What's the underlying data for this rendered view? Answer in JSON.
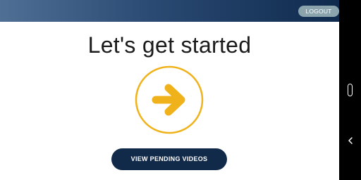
{
  "header": {
    "logout_label": "LOGOUT"
  },
  "main": {
    "title": "Let's get started",
    "start_icon": "arrow-right-icon",
    "pending_label": "VIEW PENDING VIDEOS"
  },
  "system_nav": {
    "home_icon": "home-pill-icon",
    "back_icon": "chevron-left-icon"
  },
  "colors": {
    "header_gradient_start": "#4f6f95",
    "header_gradient_end": "#0f2a4d",
    "logout_bg": "#8aa3ad",
    "accent_yellow": "#f0b21b",
    "primary_button": "#122a4a",
    "nav_bar": "#000000"
  }
}
